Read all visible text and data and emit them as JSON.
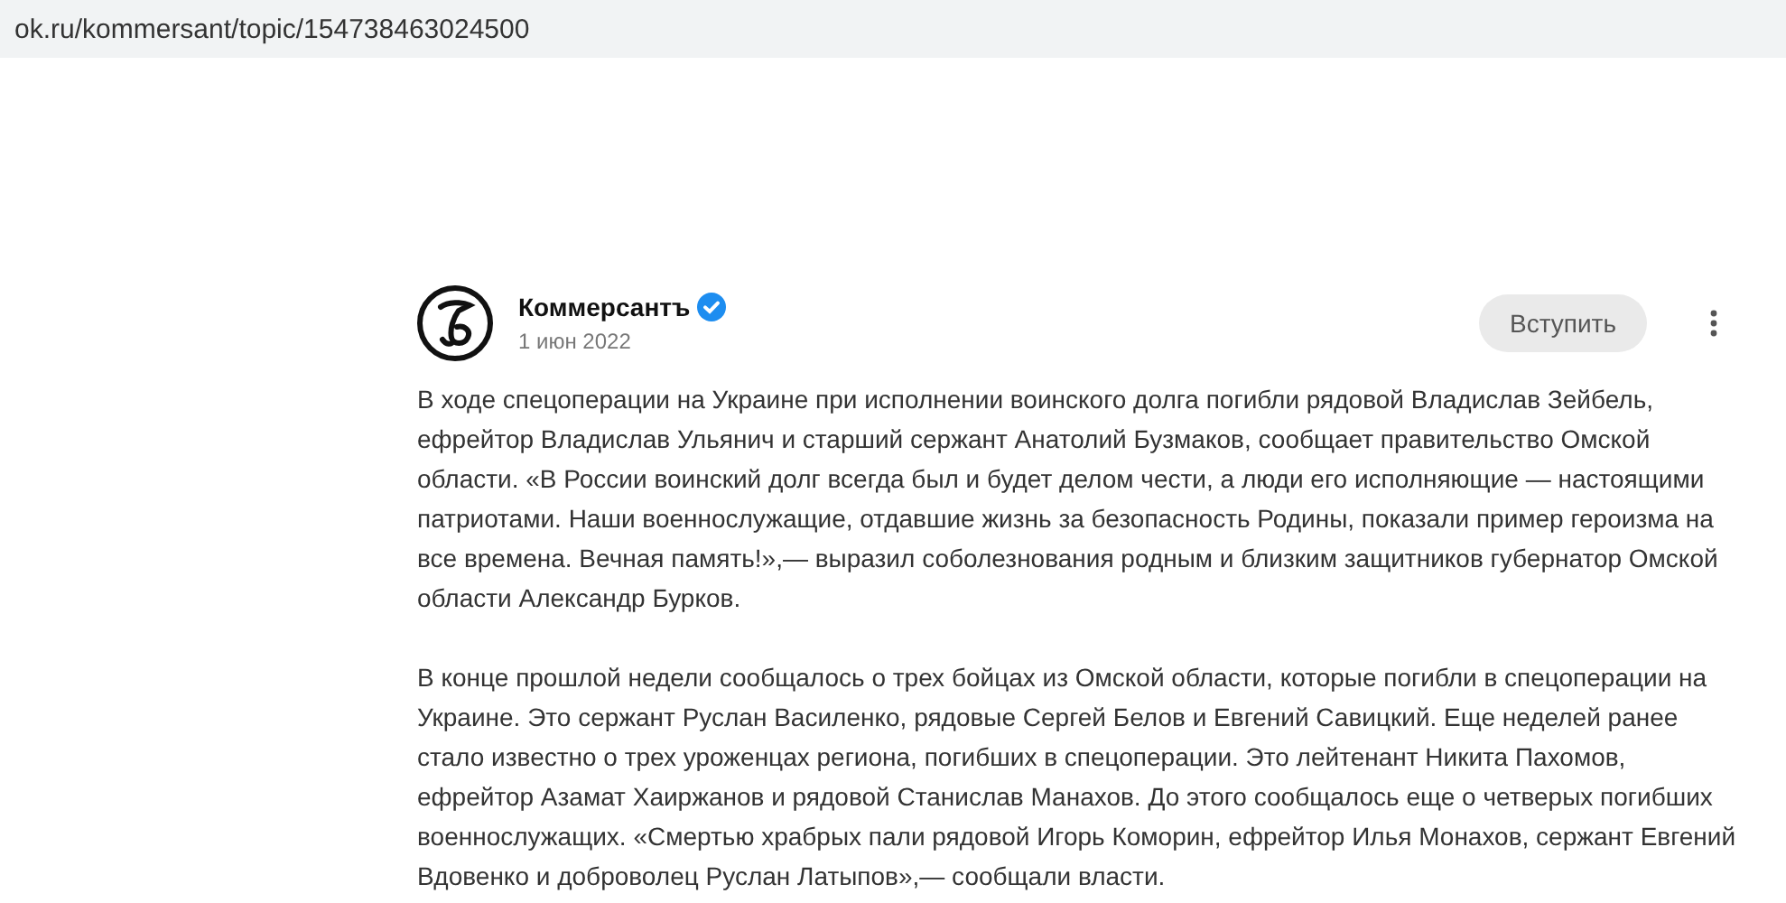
{
  "address_bar": {
    "url": "ok.ru/kommersant/topic/154738463024500"
  },
  "post": {
    "author": "Коммерсантъ",
    "verified": true,
    "date": "1 июн 2022",
    "join_button": "Вступить",
    "paragraphs": [
      "В ходе спецоперации на Украине при исполнении воинского долга погибли рядовой Владислав Зейбель, ефрейтор Владислав Ульянич и старший сержант Анатолий Бузмаков, сообщает правительство Омской области. «В России воинский долг всегда был и будет делом чести, а люди его исполняющие — настоящими патриотами. Наши военнослужащие, отдавшие жизнь за безопасность Родины, показали пример героизма на все времена. Вечная память!»,— выразил соболезнования родным и близким защитников губернатор Омской области Александр Бурков.",
      "В конце прошлой недели сообщалось о трех бойцах из Омской области, которые погибли в спецоперации на Украине. Это сержант Руслан Василенко, рядовые Сергей Белов и Евгений Савицкий. Еще неделей ранее стало известно о трех уроженцах региона, погибших в спецоперации. Это лейтенант Никита Пахомов, ефрейтор Азамат Хаиржанов и рядовой Станислав Манахов. До этого сообщалось еще о четверых погибших военнослужащих. «Смертью храбрых пали рядовой Игорь Коморин, ефрейтор Илья Монахов, сержант Евгений Вдовенко и доброволец Руслан Латыпов»,— сообщали власти."
    ]
  }
}
